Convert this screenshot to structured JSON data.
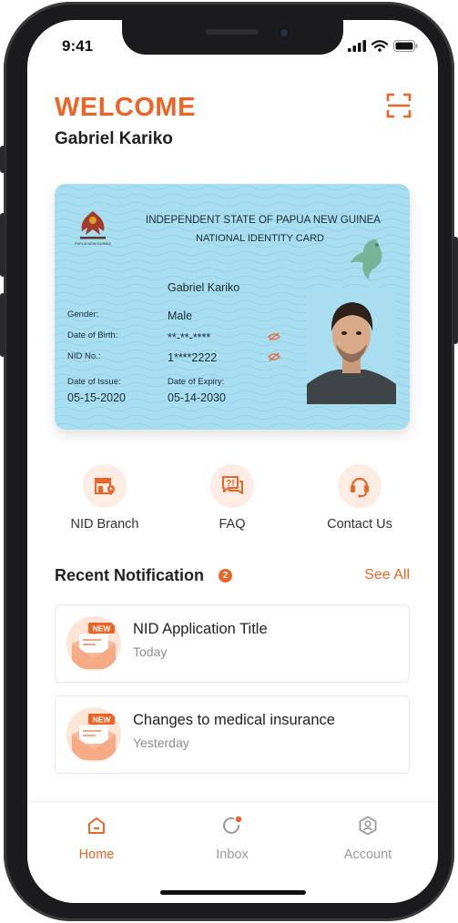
{
  "status_bar": {
    "time": "9:41"
  },
  "header": {
    "welcome": "WELCOME",
    "user_name": "Gabriel Kariko"
  },
  "id_card": {
    "emblem_text": "PAPUA NEW GUINEA",
    "title": "INDEPENDENT STATE OF PAPUA NEW GUINEA",
    "subtitle": "NATIONAL IDENTITY CARD",
    "name": "Gabriel Kariko",
    "gender_label": "Gender:",
    "gender_value": "Male",
    "dob_label": "Date of Birth:",
    "dob_value": "**-**-****",
    "nid_label": "NID No.:",
    "nid_value": "1****2222",
    "issue_label": "Date of Issue:",
    "issue_value": "05-15-2020",
    "expiry_label": "Date of Expiry:",
    "expiry_value": "05-14-2030"
  },
  "quick_actions": [
    {
      "label": "NID Branch",
      "icon": "branch-location-icon"
    },
    {
      "label": "FAQ",
      "icon": "faq-icon"
    },
    {
      "label": "Contact Us",
      "icon": "headset-icon"
    }
  ],
  "notifications": {
    "title": "Recent Notification",
    "count": "2",
    "see_all": "See All",
    "items": [
      {
        "badge": "NEW",
        "title": "NID Application Title",
        "date": "Today"
      },
      {
        "badge": "NEW",
        "title": "Changes to medical insurance",
        "date": "Yesterday"
      }
    ]
  },
  "tab_bar": {
    "tabs": [
      {
        "label": "Home",
        "icon": "home-icon",
        "active": true
      },
      {
        "label": "Inbox",
        "icon": "inbox-icon",
        "active": false
      },
      {
        "label": "Account",
        "icon": "account-icon",
        "active": false
      }
    ]
  },
  "colors": {
    "accent": "#EE6426",
    "card_bg": "#A8DEF0",
    "text": "#222222",
    "muted": "#8C8C8C"
  }
}
